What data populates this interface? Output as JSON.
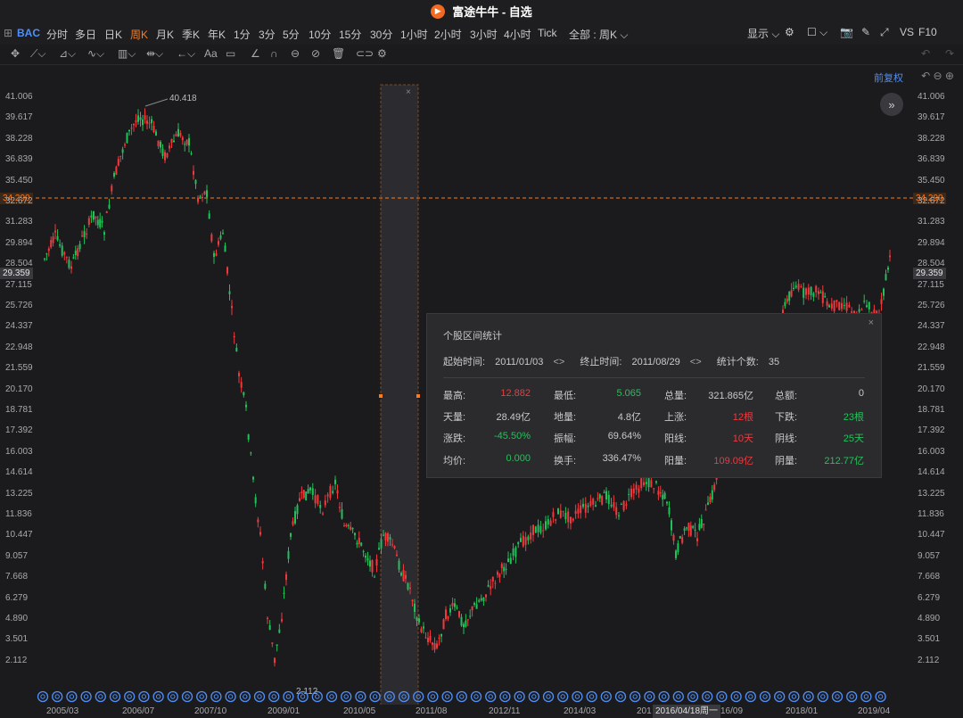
{
  "window": {
    "title": "富途牛牛 - 自选",
    "logo_glyph": "▶"
  },
  "toolbar": {
    "symbol": "BAC",
    "periods": [
      "分时",
      "多日",
      "日K",
      "周K",
      "月K",
      "季K",
      "年K",
      "1分",
      "3分",
      "5分",
      "10分",
      "15分",
      "30分",
      "1小时",
      "2小时",
      "3小时",
      "4小时",
      "Tick"
    ],
    "active_period": "周K",
    "range_select": "全部 : 周K",
    "display": "显示",
    "vs": "VS",
    "f10": "F10"
  },
  "chart_meta": {
    "adjust_label": "前复权",
    "high_marker": "40.418",
    "low_marker": "2.112",
    "crosshair_price": "34.290",
    "last_price": "29.359",
    "selection_close": "×",
    "date_flag": "2016/04/18周一"
  },
  "colors": {
    "up": "#f0393d",
    "down": "#22c25a",
    "accent": "#ff7a1a",
    "link": "#4f8ff7",
    "bg": "#1b1b1e"
  },
  "y_labels": [
    "41.006",
    "39.617",
    "38.228",
    "36.839",
    "35.450",
    "34.290",
    "32.672",
    "31.283",
    "29.894",
    "29.359",
    "28.504",
    "27.115",
    "25.726",
    "24.337",
    "22.948",
    "21.559",
    "20.170",
    "18.781",
    "17.392",
    "16.003",
    "14.614",
    "13.225",
    "11.836",
    "10.447",
    "9.057",
    "7.668",
    "6.279",
    "4.890",
    "3.501",
    "2.112"
  ],
  "x_labels": [
    "2005/03",
    "2006/07",
    "2007/10",
    "2009/01",
    "2010/05",
    "2011/08",
    "2012/11",
    "2014/03",
    "201",
    "16/09",
    "2018/01",
    "2019/04"
  ],
  "stats": {
    "title": "个股区间统计",
    "close": "×",
    "start_label": "起始时间:",
    "start_value": "2011/01/03",
    "end_label": "终止时间:",
    "end_value": "2011/08/29",
    "count_label": "统计个数:",
    "count_value": "35",
    "rows": [
      [
        {
          "label": "最高:",
          "value": "12.882",
          "color": "red"
        },
        {
          "label": "最低:",
          "value": "5.065",
          "color": "green"
        },
        {
          "label": "总量:",
          "value": "321.865亿",
          "color": "white"
        },
        {
          "label": "总额:",
          "value": "0",
          "color": "white"
        }
      ],
      [
        {
          "label": "天量:",
          "value": "28.49亿",
          "color": "white"
        },
        {
          "label": "地量:",
          "value": "4.8亿",
          "color": "white"
        },
        {
          "label": "上涨:",
          "value": "12根",
          "color": "red"
        },
        {
          "label": "下跌:",
          "value": "23根",
          "color": "green"
        }
      ],
      [
        {
          "label": "涨跌:",
          "value": "-45.50%",
          "color": "green"
        },
        {
          "label": "振幅:",
          "value": "69.64%",
          "color": "white"
        },
        {
          "label": "阳线:",
          "value": "10天",
          "color": "red"
        },
        {
          "label": "阴线:",
          "value": "25天",
          "color": "green"
        }
      ],
      [
        {
          "label": "均价:",
          "value": "0.000",
          "color": "green"
        },
        {
          "label": "换手:",
          "value": "336.47%",
          "color": "white"
        },
        {
          "label": "阳量:",
          "value": "109.09亿",
          "color": "red"
        },
        {
          "label": "阴量:",
          "value": "212.77亿",
          "color": "green"
        }
      ]
    ]
  }
}
